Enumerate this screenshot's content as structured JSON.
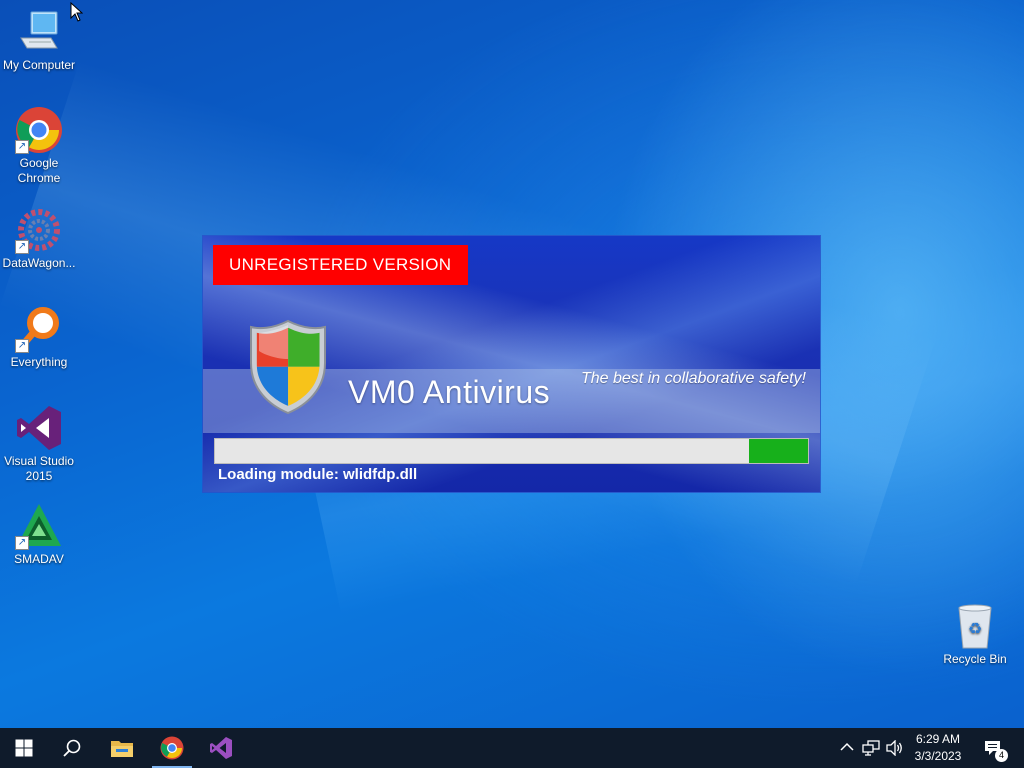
{
  "desktop": {
    "icons": [
      {
        "label": "My Computer",
        "icon": "computer-icon"
      },
      {
        "label": "Google\nChrome",
        "icon": "chrome-icon"
      },
      {
        "label": "DataWagon...",
        "icon": "datawagon-icon"
      },
      {
        "label": "Everything",
        "icon": "search-magnifier-icon"
      },
      {
        "label": "Visual Studio\n2015",
        "icon": "visual-studio-icon"
      },
      {
        "label": "SMADAV",
        "icon": "smadav-icon"
      },
      {
        "label": "Recycle Bin",
        "icon": "recycle-bin-icon"
      }
    ],
    "colors": {
      "background": "#0a64cf"
    }
  },
  "splash": {
    "badge": "UNREGISTERED VERSION",
    "title": "VM0 Antivirus",
    "tagline": "The best in collaborative safety!",
    "status": "Loading module: wlidfdp.dll",
    "progress_fraction": 0.1,
    "colors": {
      "badge": "#ff0000",
      "progress": "#17b01b",
      "panel": "#1638c6"
    }
  },
  "taskbar": {
    "buttons": [
      "start-icon",
      "search-icon",
      "file-explorer-icon",
      "chrome-icon",
      "visual-studio-icon"
    ],
    "tray_icons": [
      "chevron-up-icon",
      "network-icon",
      "volume-icon"
    ],
    "time": "6:29 AM",
    "date": "3/3/2023",
    "notification_count": "4"
  }
}
